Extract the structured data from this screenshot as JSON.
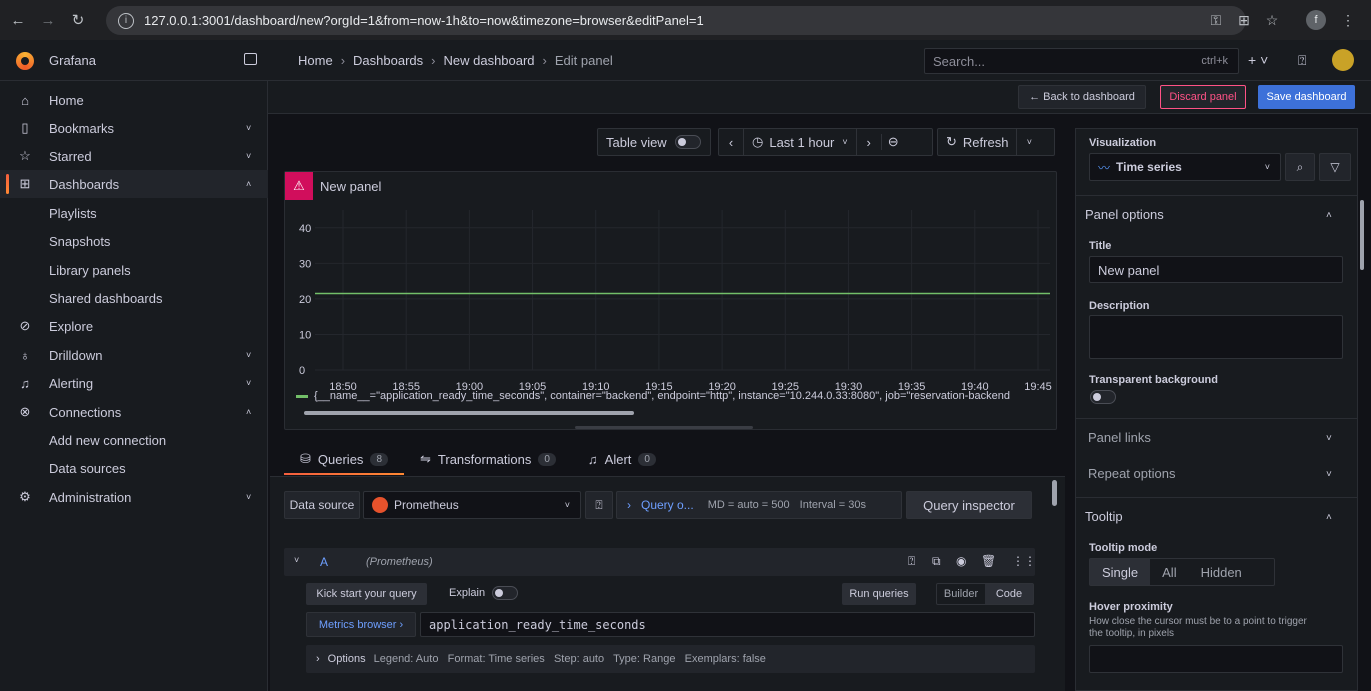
{
  "browser": {
    "url": "127.0.0.1:3001/dashboard/new?orgId=1&from=now-1h&to=now&timezone=browser&editPanel=1",
    "profile_initial": "f"
  },
  "app": {
    "brand": "Grafana",
    "breadcrumb": [
      "Home",
      "Dashboards",
      "New dashboard",
      "Edit panel"
    ],
    "search_placeholder": "Search...",
    "search_shortcut": "ctrl+k"
  },
  "sidebar": {
    "items": [
      {
        "label": "Home",
        "icon": "home-icon"
      },
      {
        "label": "Bookmarks",
        "icon": "bookmark-icon"
      },
      {
        "label": "Starred",
        "icon": "star-icon"
      },
      {
        "label": "Dashboards",
        "icon": "apps-icon"
      },
      {
        "label": "Playlists"
      },
      {
        "label": "Snapshots"
      },
      {
        "label": "Library panels"
      },
      {
        "label": "Shared dashboards"
      },
      {
        "label": "Explore",
        "icon": "compass-icon"
      },
      {
        "label": "Drilldown",
        "icon": "drilldown-icon"
      },
      {
        "label": "Alerting",
        "icon": "bell-icon"
      },
      {
        "label": "Connections",
        "icon": "plug-icon"
      },
      {
        "label": "Add new connection"
      },
      {
        "label": "Data sources"
      },
      {
        "label": "Administration",
        "icon": "cog-icon"
      }
    ]
  },
  "actions": {
    "back": "← Back to dashboard",
    "discard": "Discard panel",
    "save": "Save dashboard"
  },
  "panel_toolbar": {
    "table_view": "Table view",
    "time_range": "Last 1 hour",
    "refresh": "Refresh"
  },
  "panel": {
    "title": "New panel",
    "legend": "{__name__=\"application_ready_time_seconds\", container=\"backend\", endpoint=\"http\", instance=\"10.244.0.33:8080\", job=\"reservation-backend"
  },
  "chart_data": {
    "type": "line",
    "x": [
      "18:50",
      "18:55",
      "19:00",
      "19:05",
      "19:10",
      "19:15",
      "19:20",
      "19:25",
      "19:30",
      "19:35",
      "19:40",
      "19:45"
    ],
    "yticks": [
      0,
      10,
      20,
      30,
      40
    ],
    "ylim": [
      0,
      45
    ],
    "series": [
      {
        "values": [
          21.5,
          21.5,
          21.5,
          21.5,
          21.5,
          21.5,
          21.5,
          21.5,
          21.5,
          21.5,
          21.5,
          21.5
        ],
        "color": "#73bf69"
      }
    ],
    "grid": true,
    "legend_position": "bottom"
  },
  "query_tabs": [
    {
      "label": "Queries",
      "count": "8"
    },
    {
      "label": "Transformations",
      "count": "0"
    },
    {
      "label": "Alert",
      "count": "0"
    }
  ],
  "datasource": {
    "label": "Data source",
    "name": "Prometheus",
    "query_options": "Query o...",
    "md": "MD = auto = 500",
    "interval": "Interval = 30s",
    "inspector": "Query inspector"
  },
  "query": {
    "ref": "A",
    "ds": "(Prometheus)",
    "kickstart": "Kick start your query",
    "explain": "Explain",
    "run": "Run queries",
    "builder": "Builder",
    "code": "Code",
    "metrics_browser": "Metrics browser ›",
    "expr": "application_ready_time_seconds",
    "options_label": "Options",
    "options_summary": "Legend: Auto   Format: Time series   Step: auto   Type: Range   Exemplars: false"
  },
  "options_pane": {
    "visualization_label": "Visualization",
    "visualization": "Time series",
    "panel_options": "Panel options",
    "title_label": "Title",
    "title_value": "New panel",
    "description_label": "Description",
    "transparent_label": "Transparent background",
    "panel_links": "Panel links",
    "repeat_options": "Repeat options",
    "tooltip": "Tooltip",
    "tooltip_mode_label": "Tooltip mode",
    "tooltip_modes": [
      "Single",
      "All",
      "Hidden"
    ],
    "hover_label": "Hover proximity",
    "hover_desc": "How close the cursor must be to a point to trigger the tooltip, in pixels"
  }
}
